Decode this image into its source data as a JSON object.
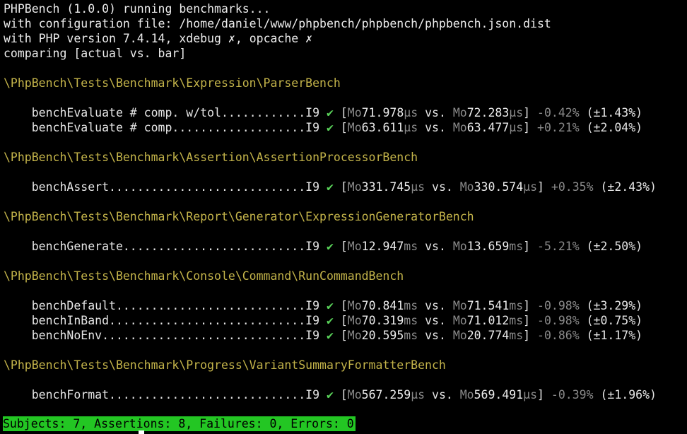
{
  "header": {
    "line1": "PHPBench (1.0.0) running benchmarks...",
    "line2": "with configuration file: /home/daniel/www/phpbench/phpbench/phpbench.json.dist",
    "line3_prefix": "with PHP version 7.4.14, xdebug ",
    "cross_icon": "✗",
    "line3_mid": ", opcache ",
    "line4": "comparing [actual vs. bar]"
  },
  "groups": [
    {
      "class": "\\PhpBench\\Tests\\Benchmark\\Expression\\ParserBench",
      "rows": [
        {
          "subject": "    benchEvaluate # comp. w/tol............I9 ",
          "check": "✔",
          "open": " [",
          "mode": "Mo",
          "actual": "71.978",
          "unit": "μs",
          "vs": " vs. ",
          "mode2": "Mo",
          "bar": "72.283",
          "unit2": "μs",
          "close": "] ",
          "diff": "-0.42%",
          "rstdev": " (±1.43%)"
        },
        {
          "subject": "    benchEvaluate # comp...................I9 ",
          "check": "✔",
          "open": " [",
          "mode": "Mo",
          "actual": "63.611",
          "unit": "μs",
          "vs": " vs. ",
          "mode2": "Mo",
          "bar": "63.477",
          "unit2": "μs",
          "close": "] ",
          "diff": "+0.21%",
          "rstdev": " (±2.04%)"
        }
      ]
    },
    {
      "class": "\\PhpBench\\Tests\\Benchmark\\Assertion\\AssertionProcessorBench",
      "rows": [
        {
          "subject": "    benchAssert............................I9 ",
          "check": "✔",
          "open": " [",
          "mode": "Mo",
          "actual": "331.745",
          "unit": "μs",
          "vs": " vs. ",
          "mode2": "Mo",
          "bar": "330.574",
          "unit2": "μs",
          "close": "] ",
          "diff": "+0.35%",
          "rstdev": " (±2.43%)"
        }
      ]
    },
    {
      "class": "\\PhpBench\\Tests\\Benchmark\\Report\\Generator\\ExpressionGeneratorBench",
      "rows": [
        {
          "subject": "    benchGenerate..........................I9 ",
          "check": "✔",
          "open": " [",
          "mode": "Mo",
          "actual": "12.947",
          "unit": "ms",
          "vs": " vs. ",
          "mode2": "Mo",
          "bar": "13.659",
          "unit2": "ms",
          "close": "] ",
          "diff": "-5.21%",
          "rstdev": " (±2.50%)"
        }
      ]
    },
    {
      "class": "\\PhpBench\\Tests\\Benchmark\\Console\\Command\\RunCommandBench",
      "rows": [
        {
          "subject": "    benchDefault...........................I9 ",
          "check": "✔",
          "open": " [",
          "mode": "Mo",
          "actual": "70.841",
          "unit": "ms",
          "vs": " vs. ",
          "mode2": "Mo",
          "bar": "71.541",
          "unit2": "ms",
          "close": "] ",
          "diff": "-0.98%",
          "rstdev": " (±3.29%)"
        },
        {
          "subject": "    benchInBand............................I9 ",
          "check": "✔",
          "open": " [",
          "mode": "Mo",
          "actual": "70.319",
          "unit": "ms",
          "vs": " vs. ",
          "mode2": "Mo",
          "bar": "71.012",
          "unit2": "ms",
          "close": "] ",
          "diff": "-0.98%",
          "rstdev": " (±0.75%)"
        },
        {
          "subject": "    benchNoEnv.............................I9 ",
          "check": "✔",
          "open": " [",
          "mode": "Mo",
          "actual": "20.595",
          "unit": "ms",
          "vs": " vs. ",
          "mode2": "Mo",
          "bar": "20.774",
          "unit2": "ms",
          "close": "] ",
          "diff": "-0.86%",
          "rstdev": " (±1.17%)"
        }
      ]
    },
    {
      "class": "\\PhpBench\\Tests\\Benchmark\\Progress\\VariantSummaryFormatterBench",
      "rows": [
        {
          "subject": "    benchFormat............................I9 ",
          "check": "✔",
          "open": " [",
          "mode": "Mo",
          "actual": "567.259",
          "unit": "μs",
          "vs": " vs. ",
          "mode2": "Mo",
          "bar": "569.491",
          "unit2": "μs",
          "close": "] ",
          "diff": "-0.39%",
          "rstdev": " (±1.96%)"
        }
      ]
    }
  ],
  "summary": "Subjects: 7, Assertions: 8, Failures: 0, Errors: 0",
  "colors": {
    "background": "#000000",
    "class_name": "#c4b44a",
    "check": "#5ad35a",
    "muted": "#8a8a8a",
    "status_bar": "#23c623"
  }
}
